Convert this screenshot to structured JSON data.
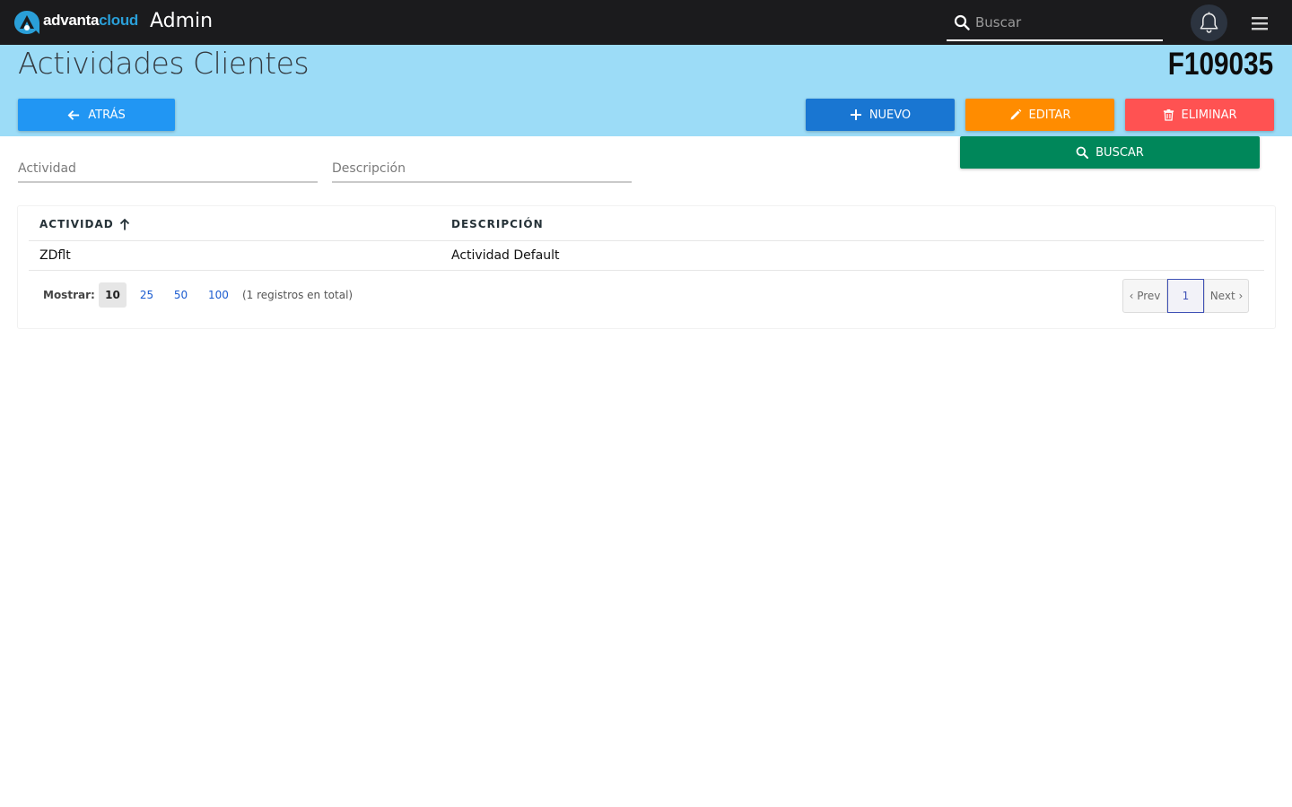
{
  "topbar": {
    "brand_part1": "advanta",
    "brand_part2": "cloud",
    "app_title": "Admin",
    "search_placeholder": "Buscar",
    "icons": {
      "logo": "advanta-logo",
      "search": "search-icon",
      "notifications": "bell-icon",
      "menu": "hamburger-menu-icon"
    }
  },
  "header": {
    "title": "Actividades Clientes",
    "code": "F109035",
    "buttons": {
      "back": "ATRÁS",
      "new": "NUEVO",
      "edit": "EDITAR",
      "delete": "ELIMINAR",
      "search": "BUSCAR"
    }
  },
  "filters": {
    "activity_placeholder": "Actividad",
    "description_placeholder": "Descripción"
  },
  "table": {
    "columns": [
      "ACTIVIDAD",
      "DESCRIPCIÓN"
    ],
    "sort": {
      "column": "ACTIVIDAD",
      "direction": "ascending"
    },
    "rows": [
      [
        "ZDflt",
        "Actividad Default"
      ]
    ]
  },
  "pagination": {
    "show_label": "Mostrar:",
    "page_sizes": [
      "10",
      "25",
      "50",
      "100"
    ],
    "selected_size": "10",
    "total_text": "(1 registros en total)",
    "prev": "‹ Prev",
    "current_page": "1",
    "next": "Next ›"
  },
  "colors": {
    "topbar": "#1b1b1d",
    "band": "#9cdcf7",
    "back": "#2196f3",
    "new": "#1976d2",
    "edit": "#ff8c00",
    "delete": "#ff5252",
    "search": "#00875a"
  }
}
